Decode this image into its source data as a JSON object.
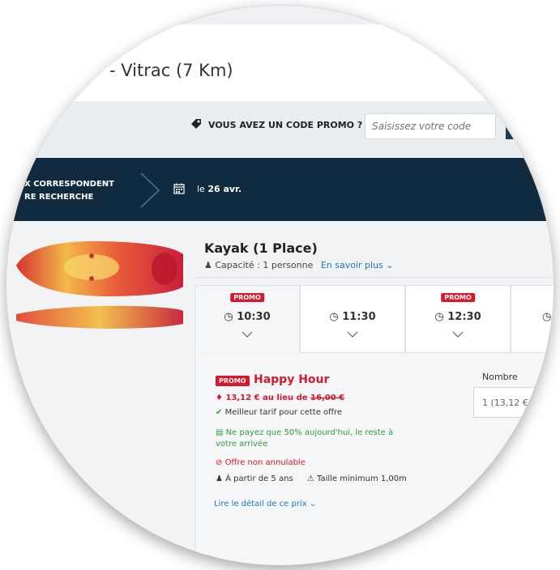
{
  "header": {
    "title": "- Vitrac (7 Km)"
  },
  "promo": {
    "label": "VOUS AVEZ UN CODE PROMO ?",
    "input_placeholder": "Saisissez votre code",
    "icon": "tag-icon"
  },
  "steps": {
    "step1_line1": "X CORRESPONDENT",
    "step1_line2": "RE RECHERCHE",
    "date_prefix": "le",
    "date_value": "26 avr."
  },
  "product": {
    "title": "Kayak (1 Place)",
    "capacity": "Capacité : 1 personne",
    "more_link": "En savoir plus"
  },
  "slots": [
    {
      "time": "10:30",
      "promo": "PROMO"
    },
    {
      "time": "11:30",
      "promo": ""
    },
    {
      "time": "12:30",
      "promo": "PROMO"
    }
  ],
  "offer": {
    "badge": "PROMO",
    "title": "Happy Hour",
    "price": "13,12 € au lieu de",
    "old_price": "16,00 €",
    "best": "Meilleur tarif pour cette offre",
    "pay_line1": "Ne payez que 50% aujourd'hui, le reste à",
    "pay_line2": "votre arrivée",
    "non_cancel": "Offre non annulable",
    "age": "À partir de 5 ans",
    "size": "Taille minimum 1,00m",
    "read_more": "Lire le détail de ce prix"
  },
  "quantity": {
    "label": "Nombre",
    "value": "1   (13,12 €"
  },
  "colors": {
    "navy": "#102b40",
    "promo_red": "#d8172a",
    "link_blue": "#1a77c9",
    "green": "#2e9c3c"
  }
}
